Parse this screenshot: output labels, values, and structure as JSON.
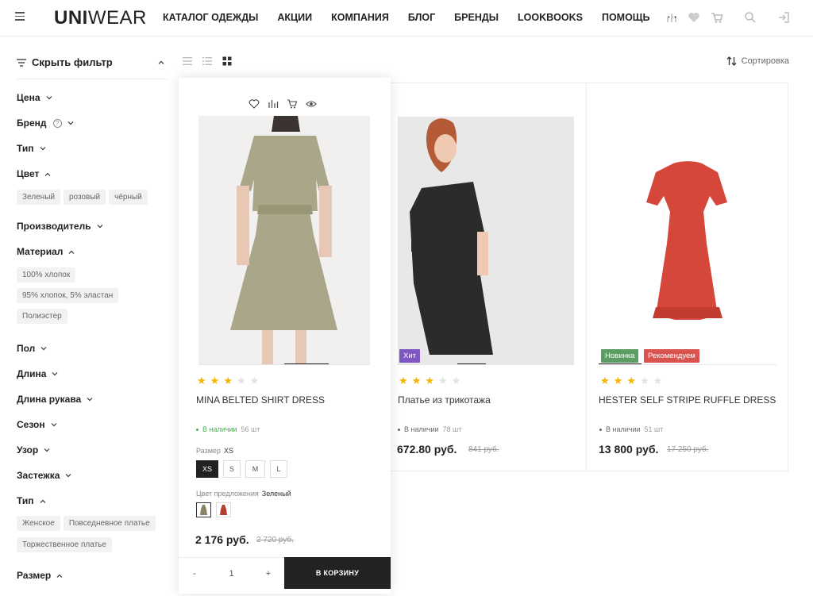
{
  "header": {
    "logo_u": "UNI",
    "logo_wear": "WEAR",
    "nav": [
      "КАТАЛОГ ОДЕЖДЫ",
      "АКЦИИ",
      "КОМПАНИЯ",
      "БЛОГ",
      "БРЕНДЫ",
      "LOOKBOOKS",
      "ПОМОЩЬ",
      "···"
    ],
    "icons": [
      "compare-icon",
      "heart-icon",
      "cart-icon",
      "search-icon",
      "login-icon"
    ]
  },
  "sidebar": {
    "hide_filter": "Скрыть фильтр",
    "price": "Цена",
    "brand": "Бренд",
    "type": "Тип",
    "color": "Цвет",
    "color_chips": [
      "Зеленый",
      "розовый",
      "чёрный"
    ],
    "manufacturer": "Производитель",
    "material": "Материал",
    "material_chips": [
      "100% хлопок",
      "95% хлопок, 5% эластан",
      "Полиэстер"
    ],
    "gender": "Пол",
    "length": "Длина",
    "sleeve_length": "Длина рукава",
    "season": "Сезон",
    "pattern": "Узор",
    "fastener": "Застежка",
    "type2": "Тип",
    "type2_chips": [
      "Женское",
      "Повседневное платье",
      "Торжественное платье"
    ],
    "size": "Размер"
  },
  "toolbar": {
    "sort": "Сортировка"
  },
  "products": [
    {
      "title": "MINA BELTED SHIRT DRESS",
      "rating": 3,
      "stock": "В наличии",
      "stock_count": "56 шт",
      "size_label": "Размер",
      "size_value": "XS",
      "sizes": [
        "XS",
        "S",
        "M",
        "L"
      ],
      "color_label": "Цвет предложения",
      "color_value": "Зеленый",
      "price": "2 176 руб.",
      "old_price": "2 720 руб.",
      "qty": "1",
      "qty_minus": "-",
      "qty_plus": "+",
      "cart": "В КОРЗИНУ"
    },
    {
      "title": "Платье из трикотажа",
      "rating": 3,
      "stock": "В наличии",
      "stock_count": "78 шт",
      "badge": "Хит",
      "price": "672.80 руб.",
      "old_price": "841 руб."
    },
    {
      "title": "HESTER SELF STRIPE RUFFLE DRESS",
      "rating": 3,
      "stock": "В наличии",
      "stock_count": "51 шт",
      "badges": [
        "Новинка",
        "Рекомендуем"
      ],
      "price": "13 800 руб.",
      "old_price": "17 250 руб."
    }
  ],
  "colors": {
    "accent": "#222222",
    "star": "#f4b400",
    "stock_green": "#4caf50",
    "badge_hit": "#7e57c2",
    "badge_new": "#5b9d62",
    "badge_rec": "#d9534f"
  }
}
